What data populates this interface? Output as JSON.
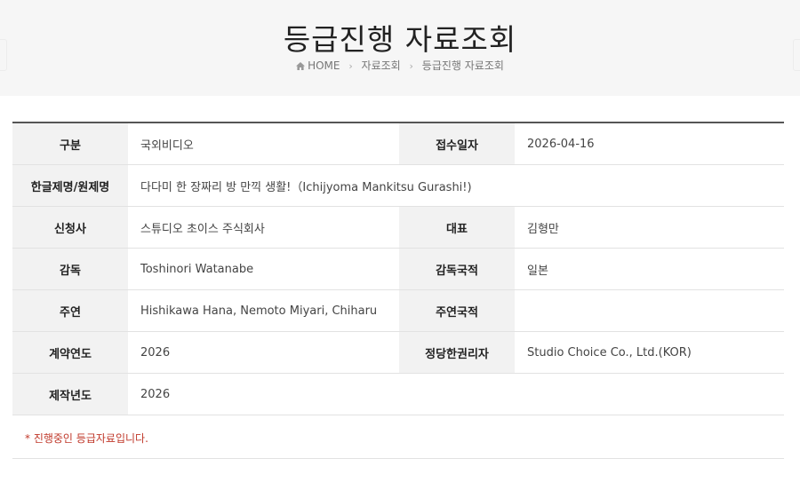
{
  "header": {
    "title": "등급진행 자료조회",
    "breadcrumb": {
      "home": "HOME",
      "level1": "자료조회",
      "level2": "등급진행 자료조회"
    }
  },
  "fields": {
    "category": {
      "label": "구분",
      "value": "국외비디오"
    },
    "received_date": {
      "label": "접수일자",
      "value": "2026-04-16"
    },
    "title": {
      "label": "한글제명/원제명",
      "value": "다다미 한 장짜리 방 만끽 생활!（Ichijyoma Mankitsu Gurashi!)"
    },
    "applicant": {
      "label": "신청사",
      "value": "스튜디오 초이스 주식회사"
    },
    "representative": {
      "label": "대표",
      "value": "김형만"
    },
    "director": {
      "label": "감독",
      "value": "Toshinori Watanabe"
    },
    "director_country": {
      "label": "감독국적",
      "value": "일본"
    },
    "cast": {
      "label": "주연",
      "value": "Hishikawa Hana, Nemoto Miyari, Chiharu"
    },
    "cast_country": {
      "label": "주연국적",
      "value": ""
    },
    "contract_year": {
      "label": "계약연도",
      "value": "2026"
    },
    "rights_holder": {
      "label": "정당한권리자",
      "value": "Studio Choice Co., Ltd.(KOR)"
    },
    "production_year": {
      "label": "제작년도",
      "value": "2026"
    }
  },
  "notice": "* 진행중인 등급자료입니다.",
  "icons": {
    "home": "home-icon",
    "breadcrumb_separator": "chevron-right-icon"
  },
  "colors": {
    "notice": "#c0392b",
    "header_bg": "#f6f6f6",
    "label_bg": "#f2f2f2"
  }
}
